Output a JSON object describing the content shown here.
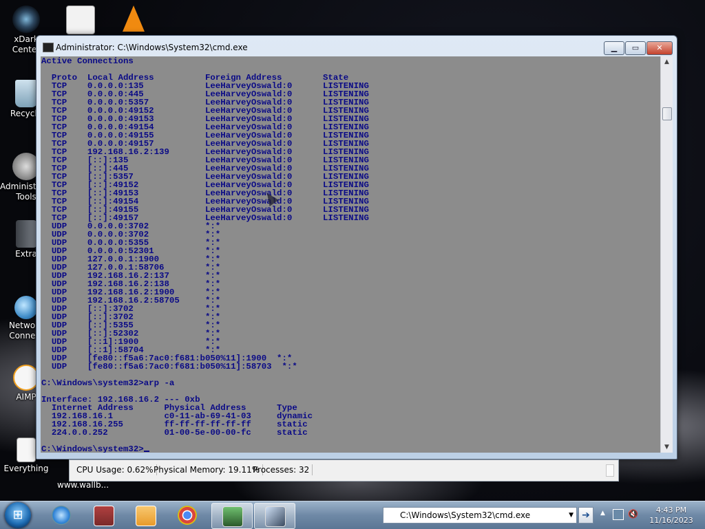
{
  "desktop": {
    "icons": [
      {
        "label": "xDark Center",
        "icon": "xdark-icon",
        "color": "#2f4a63"
      },
      {
        "label": "Recycle",
        "icon": "recycle-bin-icon",
        "color": "#7ea2b8"
      },
      {
        "label": "Administrative Tools",
        "icon": "admin-tools-icon",
        "color": "#8c8c8c"
      },
      {
        "label": "Extra",
        "icon": "folder-icon",
        "color": "#5a5f66"
      },
      {
        "label": "Network Connect",
        "icon": "network-icon",
        "color": "#3f8cc8"
      },
      {
        "label": "AIMP",
        "icon": "aimp-icon",
        "color": "#f0a020"
      },
      {
        "label": "Everything",
        "icon": "everything-icon",
        "color": "#e06020"
      }
    ],
    "top_icons": [
      {
        "icon": "document-icon"
      },
      {
        "icon": "vlc-icon"
      }
    ],
    "wallpaper_credit": "www.wallb..."
  },
  "window": {
    "title": "Administrator: C:\\Windows\\System32\\cmd.exe",
    "minimize": "▁",
    "maximize": "▭",
    "close": "✕"
  },
  "console": {
    "lines": [
      "Active Connections",
      "",
      "  Proto  Local Address          Foreign Address        State",
      "  TCP    0.0.0.0:135            LeeHarveyOswald:0      LISTENING",
      "  TCP    0.0.0.0:445            LeeHarveyOswald:0      LISTENING",
      "  TCP    0.0.0.0:5357           LeeHarveyOswald:0      LISTENING",
      "  TCP    0.0.0.0:49152          LeeHarveyOswald:0      LISTENING",
      "  TCP    0.0.0.0:49153          LeeHarveyOswald:0      LISTENING",
      "  TCP    0.0.0.0:49154          LeeHarveyOswald:0      LISTENING",
      "  TCP    0.0.0.0:49155          LeeHarveyOswald:0      LISTENING",
      "  TCP    0.0.0.0:49157          LeeHarveyOswald:0      LISTENING",
      "  TCP    192.168.16.2:139       LeeHarveyOswald:0      LISTENING",
      "  TCP    [::]:135               LeeHarveyOswald:0      LISTENING",
      "  TCP    [::]:445               LeeHarveyOswald:0      LISTENING",
      "  TCP    [::]:5357              LeeHarveyOswald:0      LISTENING",
      "  TCP    [::]:49152             LeeHarveyOswald:0      LISTENING",
      "  TCP    [::]:49153             LeeHarveyOswald:0      LISTENING",
      "  TCP    [::]:49154             LeeHarveyOswald:0      LISTENING",
      "  TCP    [::]:49155             LeeHarveyOswald:0      LISTENING",
      "  TCP    [::]:49157             LeeHarveyOswald:0      LISTENING",
      "  UDP    0.0.0.0:3702           *:*",
      "  UDP    0.0.0.0:3702           *:*",
      "  UDP    0.0.0.0:5355           *:*",
      "  UDP    0.0.0.0:52301          *:*",
      "  UDP    127.0.0.1:1900         *:*",
      "  UDP    127.0.0.1:58706        *:*",
      "  UDP    192.168.16.2:137       *:*",
      "  UDP    192.168.16.2:138       *:*",
      "  UDP    192.168.16.2:1900      *:*",
      "  UDP    192.168.16.2:58705     *:*",
      "  UDP    [::]:3702              *:*",
      "  UDP    [::]:3702              *:*",
      "  UDP    [::]:5355              *:*",
      "  UDP    [::]:52302             *:*",
      "  UDP    [::1]:1900             *:*",
      "  UDP    [::1]:58704            *:*",
      "  UDP    [fe80::f5a6:7ac0:f681:b050%11]:1900  *:*",
      "  UDP    [fe80::f5a6:7ac0:f681:b050%11]:58703  *:*",
      "",
      "C:\\Windows\\system32>arp -a",
      "",
      "Interface: 192.168.16.2 --- 0xb",
      "  Internet Address      Physical Address      Type",
      "  192.168.16.1          c0-11-ab-69-41-03     dynamic",
      "  192.168.16.255        ff-ff-ff-ff-ff-ff     static",
      "  224.0.0.252           01-00-5e-00-00-fc     static",
      ""
    ],
    "prompt": "C:\\Windows\\system32>",
    "text_color": "#0a0a86",
    "background_color": "#8c8c8c"
  },
  "status": {
    "cpu": "CPU Usage: 0.62%",
    "memory": "Physical Memory: 19.11%",
    "processes": "Processes: 32"
  },
  "taskbar": {
    "start": "start-orb-icon",
    "pinned": [
      {
        "icon": "internet-explorer-icon",
        "color": "#2a7fd4"
      },
      {
        "icon": "archive-icon",
        "color": "#b04040"
      },
      {
        "icon": "media-player-icon",
        "color": "#e89b2a"
      },
      {
        "icon": "chrome-icon",
        "color": "#d9463e"
      },
      {
        "icon": "task-manager-icon",
        "color": "#3d7a3d"
      },
      {
        "icon": "cmd-window-icon",
        "color": "#3a4a60"
      }
    ],
    "address_value": "C:\\Windows\\System32\\cmd.exe",
    "clock_time": "4:43 PM",
    "clock_date": "11/16/2023"
  }
}
